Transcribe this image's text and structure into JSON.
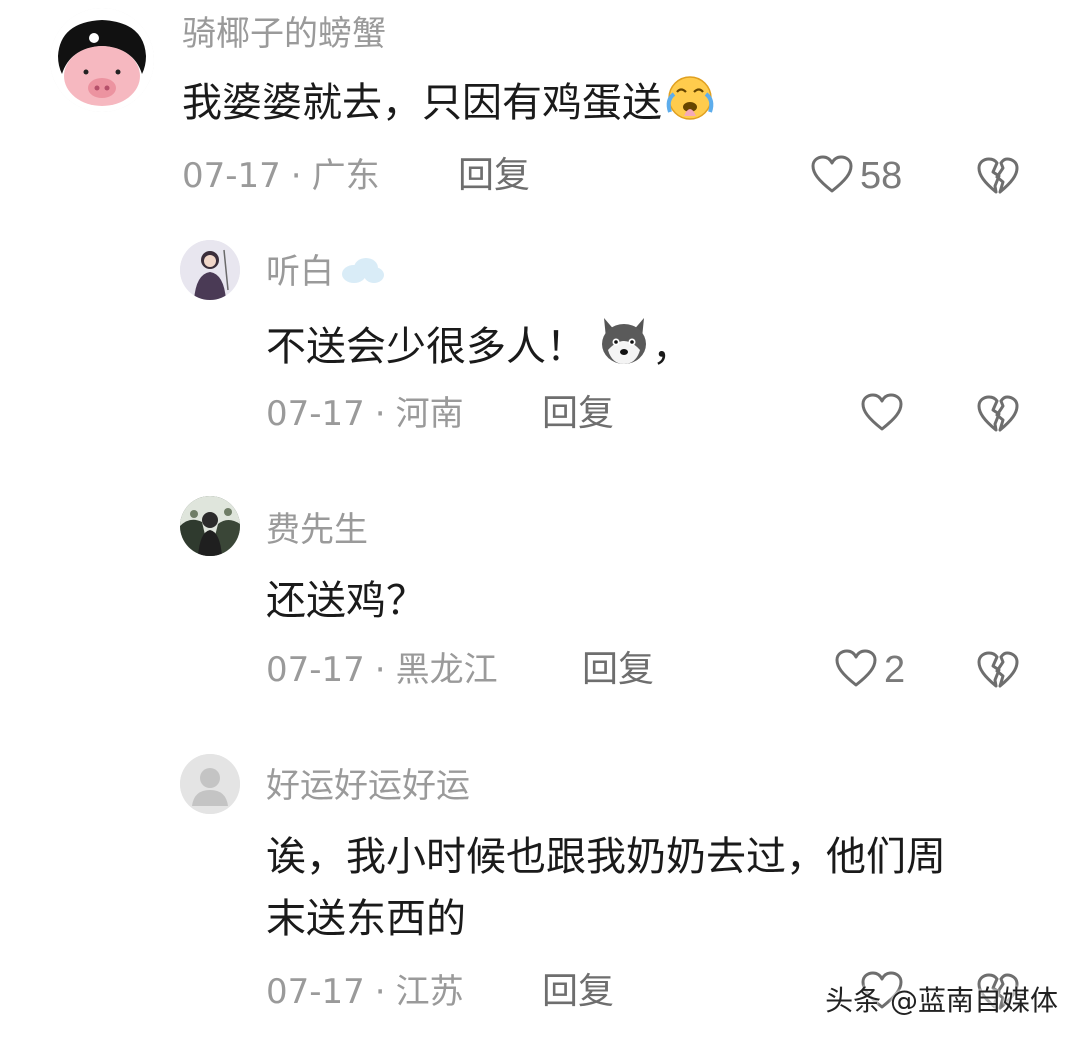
{
  "comments": [
    {
      "username": "骑椰子的螃蟹",
      "text": "我婆婆就去，只因有鸡蛋送",
      "date": "07-17",
      "location": "广东",
      "reply_label": "回复",
      "likes": "58"
    },
    {
      "username": "听白",
      "text": "不送会少很多人！",
      "text_suffix": "，",
      "date": "07-17",
      "location": "河南",
      "reply_label": "回复",
      "likes": ""
    },
    {
      "username": "费先生",
      "text": "还送鸡？",
      "date": "07-17",
      "location": "黑龙江",
      "reply_label": "回复",
      "likes": "2"
    },
    {
      "username": "好运好运好运",
      "text_line1": "诶，我小时候也跟我奶奶去过，他们周",
      "text_line2": "末送东西的",
      "date": "07-17",
      "location": "江苏",
      "reply_label": "回复",
      "likes": ""
    }
  ],
  "separator": "·",
  "watermark": "头条 @蓝南自媒体",
  "icons": {
    "like": "heart-outline-icon",
    "dislike": "broken-heart-icon",
    "crying-emoji": "crying-face-emoji-icon",
    "cloud": "cloud-icon",
    "husky": "husky-dog-emoji-icon"
  },
  "colors": {
    "username": "#9a9a9a",
    "text": "#1a1a1a",
    "meta": "#9a9a9a",
    "icon": "#6e6e6e"
  }
}
